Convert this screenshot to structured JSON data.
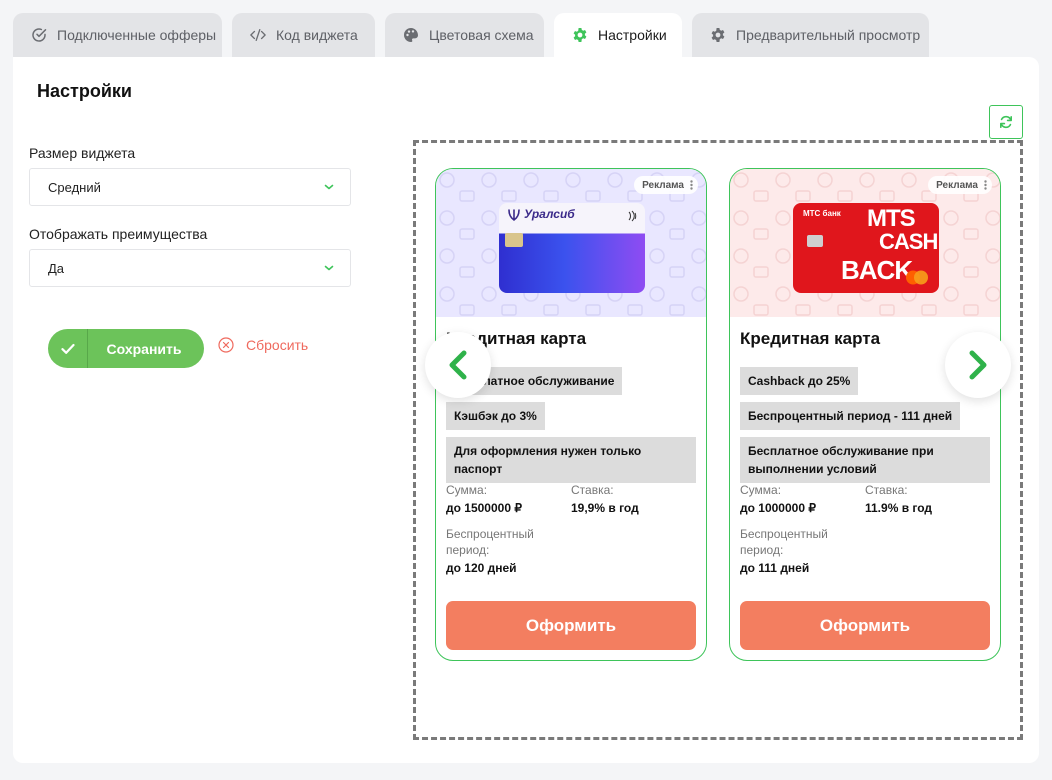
{
  "tabs": [
    {
      "label": "Подключенные офферы",
      "icon": "check-circle-icon"
    },
    {
      "label": "Код виджета",
      "icon": "code-icon"
    },
    {
      "label": "Цветовая схема",
      "icon": "palette-icon"
    },
    {
      "label": "Настройки",
      "icon": "gear-icon",
      "active": true
    },
    {
      "label": "Предварительный просмотр",
      "icon": "gear-icon"
    }
  ],
  "panel": {
    "title": "Настройки",
    "size_field": {
      "label": "Размер виджета",
      "value": "Средний"
    },
    "benefits_field": {
      "label": "Отображать преимущества",
      "value": "Да"
    },
    "save_label": "Сохранить",
    "reset_label": "Сбросить"
  },
  "colors": {
    "accent": "#3ec45a",
    "save": "#6cc35a",
    "apply": "#f37e60",
    "reset": "#ef6a5e"
  },
  "offers": [
    {
      "ad_label": "Реклама",
      "bank_name": "Уралсиб",
      "title": "Кредитная карта",
      "tags": [
        "Бесплатное обслуживание",
        "Кэшбэк до 3%",
        "Для оформления нужен только паспорт"
      ],
      "sum_label": "Сумма:",
      "sum_value": "до 1500000 ₽",
      "rate_label": "Ставка:",
      "rate_value": "19,9% в год",
      "grace_label": "Беспроцентный период:",
      "grace_value": "до 120 дней",
      "apply_label": "Оформить"
    },
    {
      "ad_label": "Реклама",
      "bank_name": "МТС банк",
      "card_text_1": "MTS",
      "card_text_2": "CASH",
      "card_text_3": "BACK",
      "title": "Кредитная карта",
      "tags": [
        "Cashback до 25%",
        "Беспроцентный период - 111 дней",
        "Бесплатное обслуживание при выполнении условий"
      ],
      "sum_label": "Сумма:",
      "sum_value": "до 1000000 ₽",
      "rate_label": "Ставка:",
      "rate_value": "11.9% в год",
      "grace_label": "Беспроцентный период:",
      "grace_value": "до 111 дней",
      "apply_label": "Оформить"
    }
  ]
}
